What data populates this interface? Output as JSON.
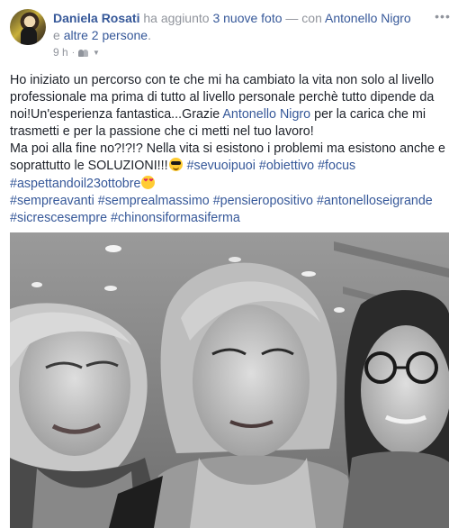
{
  "post": {
    "author": "Daniela Rosati",
    "action_text": " ha aggiunto ",
    "photos_link": "3 nuove foto",
    "with_text": " — con ",
    "tagged_person": "Antonello Nigro",
    "and_text": " e ",
    "others_link": "altre 2 persone",
    "period": ".",
    "timestamp": "9 h",
    "dot": "·",
    "audience_icon": "people-icon",
    "more_icon": "more-options-icon",
    "more_label": "•••"
  },
  "message": {
    "p1_part1": "Ho iniziato un percorso con te che mi ha cambiato la vita non solo al livello professionale ma prima di tutto al livello personale perchè tutto dipende da noi!Un'esperienza fantastica...Grazie ",
    "p1_mention": "Antonello Nigro",
    "p1_part2": " per la carica che mi trasmetti e per la passione che ci metti nel tuo lavoro!",
    "p2_part1": "Ma poi alla fine no?!?!? Nella vita si esistono i problemi ma esistono anche e soprattutto le SOLUZIONI!!!",
    "emoji1": "smiling-face-with-sunglasses",
    "tags_line1": [
      "#sevuoipuoi",
      "#obiettivo",
      "#focus"
    ],
    "tag_line2": "#aspettandoil23ottobre",
    "emoji2": "smiling-face-with-heart-eyes",
    "tags_line3": [
      "#sempreavanti",
      "#semprealmassimo",
      "#pensieropositivo",
      "#antonelloseigrande"
    ],
    "tags_line4": [
      "#sicrescesempre",
      "#chinonsiformasiferma"
    ]
  },
  "photo": {
    "description_icon": "selfie-photo",
    "style": "grayscale"
  }
}
